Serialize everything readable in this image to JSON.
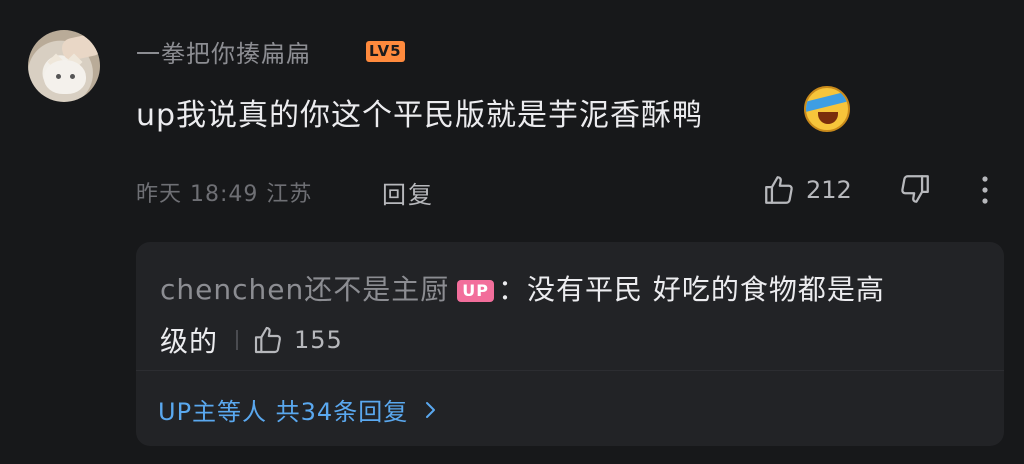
{
  "comment": {
    "username": "一拳把你揍扁扁",
    "level": "LV5",
    "text": "up我说真的你这个平民版就是芋泥香酥鸭",
    "emoji_icon": "laughing-crying-emoji",
    "meta": "昨天 18:49 江苏",
    "reply_label": "回复",
    "like_count": "212"
  },
  "reply": {
    "username": "chenchen还不是主厨",
    "badge": "UP",
    "text_line1": "：没有平民 好吃的食物都是高",
    "text_line2": "级的",
    "like_count": "155",
    "view_more": "UP主等人 共34条回复"
  },
  "colors": {
    "background": "#17181a",
    "reply_background": "#222326",
    "link_blue": "#5aa8ef",
    "level_orange": "#ff8a3d",
    "up_pink": "#f26e9b"
  }
}
